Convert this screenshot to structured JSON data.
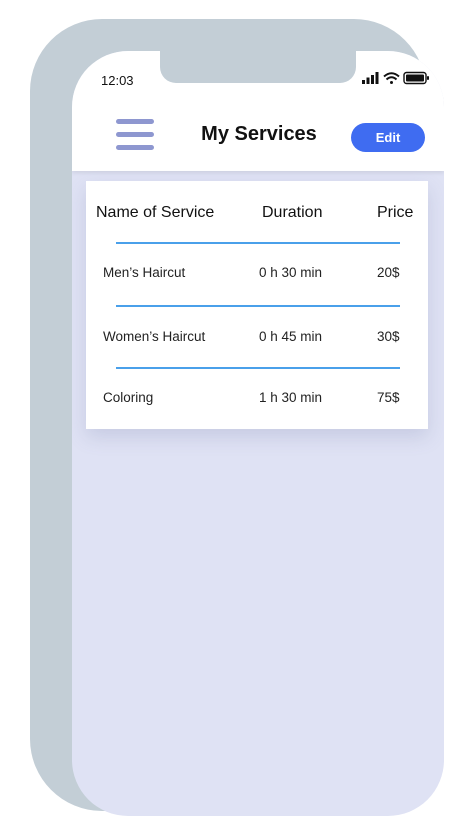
{
  "status_bar": {
    "time": "12:03",
    "icons": [
      "signal-icon",
      "wifi-icon",
      "battery-icon"
    ]
  },
  "header": {
    "title": "My Services",
    "edit_label": "Edit",
    "menu_icon": "hamburger-menu-icon"
  },
  "table": {
    "columns": {
      "name": "Name of Service",
      "duration": "Duration",
      "price": "Price"
    },
    "rows": [
      {
        "name": "Men’s Haircut",
        "duration": "0 h 30 min",
        "price": "20$"
      },
      {
        "name": "Women’s Haircut",
        "duration": "0 h 45 min",
        "price": "30$"
      },
      {
        "name": "Coloring",
        "duration": "1 h 30 min",
        "price": "75$"
      }
    ]
  },
  "colors": {
    "accent": "#3f6cf1",
    "divider": "#4aa0ea",
    "menu": "#8e97d0",
    "background": "#dfe2f4",
    "frame": "#c3ced6"
  }
}
